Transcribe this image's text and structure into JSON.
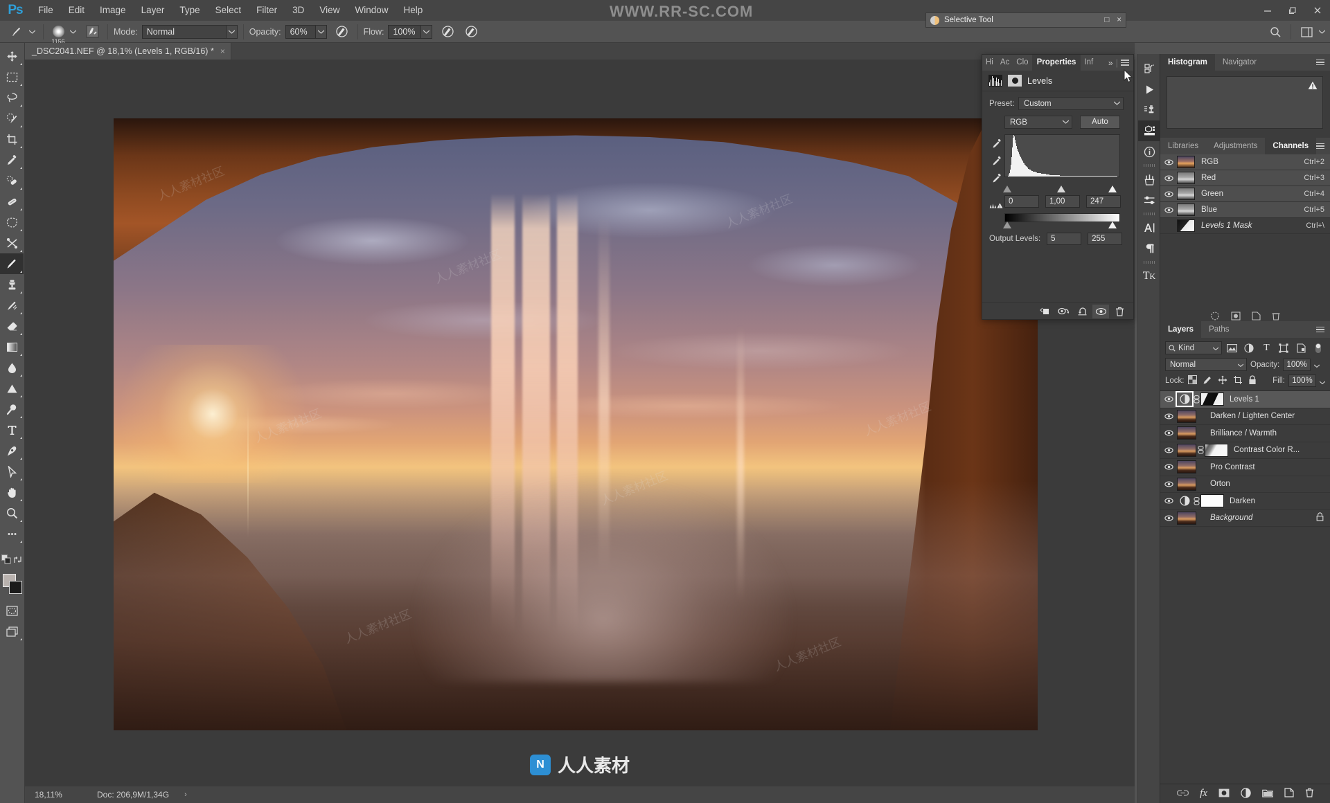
{
  "app": {
    "logo": "Ps",
    "watermark_top": "WWW.RR-SC.COM"
  },
  "menubar": {
    "items": [
      "File",
      "Edit",
      "Image",
      "Layer",
      "Type",
      "Select",
      "Filter",
      "3D",
      "View",
      "Window",
      "Help"
    ],
    "window_controls": [
      "minimize",
      "maximize",
      "close"
    ]
  },
  "options_bar": {
    "brush_tip_icon": "brush-tip-icon",
    "brush_size": "1156",
    "brush_preset_icon": "brush-preset-icon",
    "mode_label": "Mode:",
    "mode_value": "Normal",
    "opacity_label": "Opacity:",
    "opacity_value": "60%",
    "opacity_pressure_icon": "pressure-opacity-icon",
    "flow_label": "Flow:",
    "flow_value": "100%",
    "airbrush_icon": "airbrush-icon",
    "smoothing_icon": "smoothing-icon",
    "search_icon": "search-icon",
    "workspace_icon": "workspace-icon"
  },
  "document_tab": {
    "title": "_DSC2041.NEF @ 18,1% (Levels 1, RGB/16) *",
    "close": "×"
  },
  "selective_tool_window": {
    "title": "Selective Tool",
    "maximize": "□",
    "close": "×"
  },
  "toolbar": {
    "tools": [
      {
        "name": "move-tool",
        "selected": false
      },
      {
        "name": "rectangular-marquee-tool",
        "selected": false
      },
      {
        "name": "lasso-tool",
        "selected": false
      },
      {
        "name": "quick-selection-tool",
        "selected": false
      },
      {
        "name": "crop-tool",
        "selected": false
      },
      {
        "name": "eyedropper-tool",
        "selected": false
      },
      {
        "name": "spot-healing-brush-tool",
        "selected": false
      },
      {
        "name": "healing-brush-tool",
        "selected": false
      },
      {
        "name": "patch-tool",
        "selected": false
      },
      {
        "name": "shuffle-tool",
        "selected": false
      },
      {
        "name": "brush-tool",
        "selected": true
      },
      {
        "name": "clone-stamp-tool",
        "selected": false
      },
      {
        "name": "history-brush-tool",
        "selected": false
      },
      {
        "name": "eraser-tool",
        "selected": false
      },
      {
        "name": "gradient-tool",
        "selected": false
      },
      {
        "name": "blur-tool",
        "selected": false
      },
      {
        "name": "dodge-tool",
        "selected": false
      },
      {
        "name": "burn-tool",
        "selected": false
      },
      {
        "name": "type-tool",
        "selected": false
      },
      {
        "name": "pen-tool",
        "selected": false
      },
      {
        "name": "path-selection-tool",
        "selected": false
      },
      {
        "name": "hand-tool",
        "selected": false
      },
      {
        "name": "zoom-tool",
        "selected": false
      },
      {
        "name": "edit-toolbar-tool",
        "selected": false
      }
    ],
    "foreground_color": "#b9b2ae",
    "background_color": "#1b1b1b",
    "quick-mask-icon": "quick-mask-icon",
    "screen-mode-icon": "screen-mode-icon"
  },
  "properties_panel": {
    "tabs": [
      {
        "label": "Hi",
        "active": false
      },
      {
        "label": "Ac",
        "active": false
      },
      {
        "label": "Clo",
        "active": false
      },
      {
        "label": "Properties",
        "active": true
      },
      {
        "label": "Inf",
        "active": false
      }
    ],
    "overflow": "»",
    "title": "Levels",
    "preset_label": "Preset:",
    "preset_value": "Custom",
    "channel_value": "RGB",
    "auto_label": "Auto",
    "input_black": "0",
    "input_gamma": "1,00",
    "input_white": "247",
    "output_levels_label": "Output Levels:",
    "output_black": "5",
    "output_white": "255",
    "footer_buttons": [
      "clip-to-layer-icon",
      "view-previous-state-icon",
      "reset-icon",
      "toggle-visibility-icon",
      "delete-icon"
    ],
    "histogram": [
      2,
      5,
      9,
      16,
      28,
      46,
      70,
      94,
      100,
      96,
      88,
      80,
      73,
      67,
      62,
      58,
      54,
      50,
      46,
      43,
      40,
      37,
      34,
      31,
      29,
      27,
      25,
      23,
      21,
      19,
      18,
      17,
      16,
      15,
      14,
      13,
      12,
      12,
      11,
      11,
      10,
      10,
      9,
      9,
      9,
      8,
      8,
      8,
      7,
      7,
      7,
      6,
      6,
      6,
      6,
      5,
      5,
      5,
      5,
      5,
      4,
      4,
      4,
      4,
      4,
      4,
      3,
      3,
      3,
      3,
      3,
      3,
      3,
      3,
      3,
      2,
      2,
      2,
      2,
      2,
      2,
      2,
      2,
      2,
      2,
      2,
      2,
      2,
      2,
      2,
      2,
      2,
      1,
      1,
      1,
      1,
      1,
      1,
      1,
      1,
      1,
      1,
      1,
      1,
      1,
      1,
      1,
      1,
      1,
      1,
      1,
      1,
      1,
      1,
      1,
      1,
      1,
      1,
      1,
      1,
      1,
      1,
      1,
      1,
      1,
      1,
      1,
      1,
      1,
      1,
      1,
      1,
      1,
      1,
      1,
      1,
      1,
      1,
      1,
      1,
      1,
      1,
      1,
      1,
      1,
      1,
      1,
      1,
      1,
      1,
      1,
      1,
      1,
      1,
      1,
      1,
      1,
      1
    ]
  },
  "right_icon_strip": {
    "icons": [
      {
        "name": "history-icon",
        "active": false
      },
      {
        "name": "actions-play-icon",
        "active": false
      },
      {
        "name": "clone-source-icon",
        "active": false
      },
      {
        "name": "properties-icon",
        "active": true
      },
      {
        "name": "info-icon",
        "active": false
      },
      {
        "name": "brushes-icon",
        "active": false
      },
      {
        "name": "brush-settings-icon",
        "active": false
      },
      {
        "name": "character-icon",
        "active": false
      },
      {
        "name": "paragraph-icon",
        "active": false
      },
      {
        "name": "tk-panel-icon",
        "active": false
      }
    ]
  },
  "histogram_panel": {
    "tabs": [
      {
        "label": "Histogram",
        "active": true
      },
      {
        "label": "Navigator",
        "active": false
      }
    ],
    "warning_icon": "cached-data-warning-icon",
    "menu_icon": "panel-menu-icon"
  },
  "channels_panel": {
    "tabs": [
      {
        "label": "Libraries",
        "active": false
      },
      {
        "label": "Adjustments",
        "active": false
      },
      {
        "label": "Channels",
        "active": true
      }
    ],
    "menu_icon": "panel-menu-icon",
    "channels": [
      {
        "name": "RGB",
        "shortcut": "Ctrl+2",
        "visible": true,
        "selected": true,
        "italic": false,
        "thumb": "composite"
      },
      {
        "name": "Red",
        "shortcut": "Ctrl+3",
        "visible": true,
        "selected": true,
        "italic": false,
        "thumb": "gray"
      },
      {
        "name": "Green",
        "shortcut": "Ctrl+4",
        "visible": true,
        "selected": true,
        "italic": false,
        "thumb": "gray"
      },
      {
        "name": "Blue",
        "shortcut": "Ctrl+5",
        "visible": true,
        "selected": true,
        "italic": false,
        "thumb": "gray"
      },
      {
        "name": "Levels 1 Mask",
        "shortcut": "Ctrl+\\",
        "visible": false,
        "selected": false,
        "italic": true,
        "thumb": "mask"
      }
    ],
    "footer_icons": [
      "load-channel-as-selection-icon",
      "save-selection-as-channel-icon",
      "create-new-channel-icon",
      "delete-channel-icon"
    ]
  },
  "layers_panel": {
    "tabs": [
      {
        "label": "Layers",
        "active": true
      },
      {
        "label": "Paths",
        "active": false
      }
    ],
    "menu_icon": "panel-menu-icon",
    "filter_label": "Kind",
    "filter_icons": [
      "filter-pixel-icon",
      "filter-adjustment-icon",
      "filter-type-icon",
      "filter-shape-icon",
      "filter-smart-object-icon"
    ],
    "filter_toggle": "filter-enable-toggle",
    "blend_mode": "Normal",
    "opacity_label": "Opacity:",
    "opacity_value": "100%",
    "lock_label": "Lock:",
    "lock_icons": [
      "lock-transparent-pixels-icon",
      "lock-image-pixels-icon",
      "lock-position-icon",
      "lock-artboard-nesting-icon",
      "lock-all-icon"
    ],
    "fill_label": "Fill:",
    "fill_value": "100%",
    "layers": [
      {
        "name": "Levels 1",
        "visible": true,
        "selected": true,
        "type": "adjustment",
        "mask": "dark",
        "linked": true,
        "italic": false,
        "locked": false
      },
      {
        "name": "Darken / Lighten Center",
        "visible": true,
        "selected": false,
        "type": "pixel",
        "mask": null,
        "linked": false,
        "italic": false,
        "locked": false
      },
      {
        "name": "Brilliance / Warmth",
        "visible": true,
        "selected": false,
        "type": "pixel",
        "mask": null,
        "linked": false,
        "italic": false,
        "locked": false
      },
      {
        "name": "Contrast Color R...",
        "visible": true,
        "selected": false,
        "type": "pixel",
        "mask": "light",
        "linked": true,
        "italic": false,
        "locked": false
      },
      {
        "name": "Pro Contrast",
        "visible": true,
        "selected": false,
        "type": "pixel",
        "mask": null,
        "linked": false,
        "italic": false,
        "locked": false
      },
      {
        "name": "Orton",
        "visible": true,
        "selected": false,
        "type": "pixel",
        "mask": null,
        "linked": false,
        "italic": false,
        "locked": false
      },
      {
        "name": "Darken",
        "visible": true,
        "selected": false,
        "type": "adjustment",
        "mask": "white",
        "linked": true,
        "italic": false,
        "locked": false
      },
      {
        "name": "Background",
        "visible": true,
        "selected": false,
        "type": "pixel",
        "mask": null,
        "linked": false,
        "italic": true,
        "locked": true
      }
    ],
    "footer_icons": [
      "link-layers-icon",
      "layer-style-fx-icon",
      "add-layer-mask-icon",
      "new-adjustment-layer-icon",
      "new-group-icon",
      "new-layer-icon",
      "delete-layer-icon"
    ]
  },
  "status_bar": {
    "zoom": "18,11%",
    "doc_label": "Doc: 206,9M/1,34G",
    "expand_arrow": "›"
  },
  "canvas_watermark": {
    "brand": "人人素材",
    "tile_text": "人人素材社区"
  },
  "colors": {
    "app_bg": "#535353",
    "panel_bg": "#3c3c3c",
    "tab_bg": "#464646",
    "canvas_bg": "#3b3b3b",
    "accent": "#2f9fd8",
    "selected_row": "#585858"
  }
}
